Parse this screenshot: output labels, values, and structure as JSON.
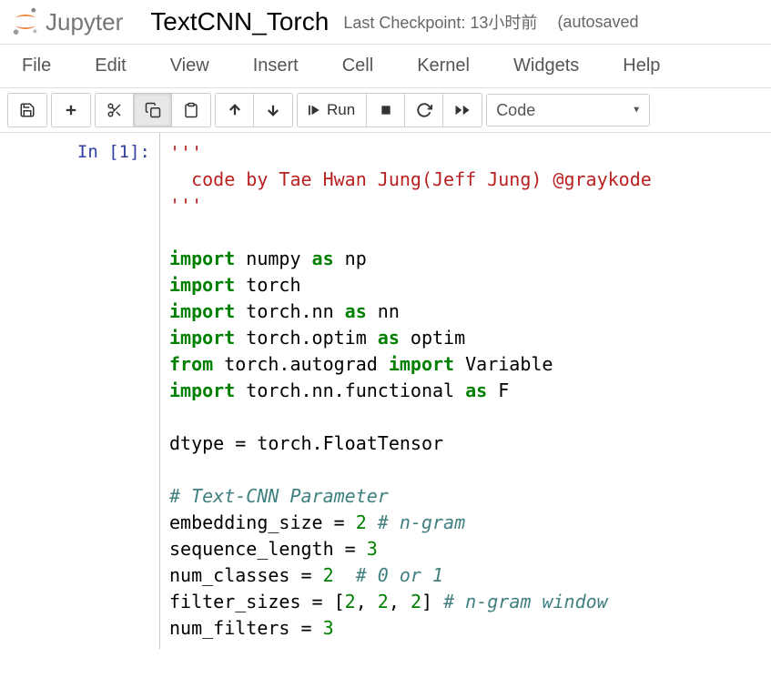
{
  "header": {
    "logo_text": "Jupyter",
    "title": "TextCNN_Torch",
    "checkpoint": "Last Checkpoint: 13小时前",
    "autosave": "(autosaved"
  },
  "menu": {
    "file": "File",
    "edit": "Edit",
    "view": "View",
    "insert": "Insert",
    "cell": "Cell",
    "kernel": "Kernel",
    "widgets": "Widgets",
    "help": "Help"
  },
  "toolbar": {
    "run_label": "Run",
    "cell_type": "Code"
  },
  "cell": {
    "prompt": "In [1]:",
    "code": {
      "tq1": "'''",
      "docstring": "  code by Tae Hwan Jung(Jeff Jung) @graykode",
      "tq2": "'''",
      "imp": "import",
      "frm": "from",
      "as": "as",
      "np_mod": " numpy ",
      "np_alias": " np",
      "torch_mod": " torch",
      "nn_mod": " torch.nn ",
      "nn_alias": " nn",
      "optim_mod": " torch.optim ",
      "optim_alias": " optim",
      "autograd_mod": " torch.autograd ",
      "var_name": " Variable",
      "func_mod": " torch.nn.functional ",
      "f_alias": " F",
      "dtype_line": "dtype = torch.FloatTensor",
      "cm_param": "# Text-CNN Parameter",
      "emb_pre": "embedding_size = ",
      "emb_val": "2",
      "emb_cm": " # n-gram",
      "seq_pre": "sequence_length = ",
      "seq_val": "3",
      "cls_pre": "num_classes = ",
      "cls_val": "2",
      "cls_cm": "  # 0 or 1",
      "fs_pre": "filter_sizes = [",
      "fs_v1": "2",
      "fs_c1": ", ",
      "fs_v2": "2",
      "fs_c2": ", ",
      "fs_v3": "2",
      "fs_end": "]",
      "fs_cm": " # n-gram window",
      "nf_pre": "num_filters = ",
      "nf_val": "3"
    }
  }
}
